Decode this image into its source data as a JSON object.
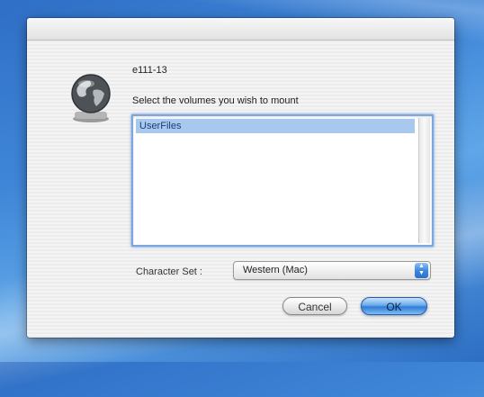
{
  "dialog": {
    "server_name": "e111-13",
    "prompt": "Select the volumes you wish to mount",
    "volumes": [
      "UserFiles"
    ],
    "charset_label": "Character Set :",
    "charset_value": "Western (Mac)",
    "cancel_label": "Cancel",
    "ok_label": "OK"
  },
  "icons": {
    "server": "globe-icon",
    "select": "up-down-arrows-icon"
  },
  "colors": {
    "desktop": "#3f86d8",
    "selection": "#a9c8ee",
    "default_button": "#2f7bd6"
  }
}
